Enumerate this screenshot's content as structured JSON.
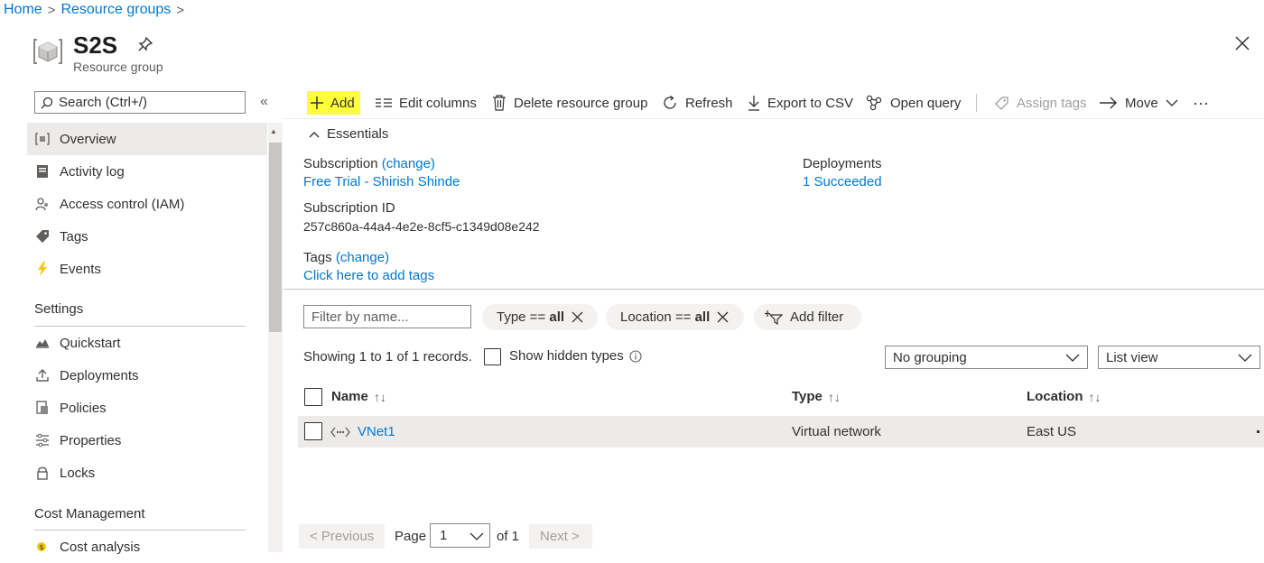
{
  "breadcrumb": {
    "home": "Home",
    "resource_groups": "Resource groups",
    "separator": ">"
  },
  "header": {
    "title": "S2S",
    "subtitle": "Resource group"
  },
  "sidebar": {
    "search_placeholder": "Search (Ctrl+/)",
    "collapse_glyph": "«",
    "items": [
      {
        "label": "Overview",
        "icon": "overview-icon"
      },
      {
        "label": "Activity log",
        "icon": "activity-log-icon"
      },
      {
        "label": "Access control (IAM)",
        "icon": "iam-icon"
      },
      {
        "label": "Tags",
        "icon": "tag-icon"
      },
      {
        "label": "Events",
        "icon": "lightning-icon"
      }
    ],
    "settings_heading": "Settings",
    "settings_items": [
      {
        "label": "Quickstart",
        "icon": "quickstart-icon"
      },
      {
        "label": "Deployments",
        "icon": "upload-icon"
      },
      {
        "label": "Policies",
        "icon": "policy-icon"
      },
      {
        "label": "Properties",
        "icon": "properties-icon"
      },
      {
        "label": "Locks",
        "icon": "lock-icon"
      }
    ],
    "cost_heading": "Cost Management",
    "cost_items": [
      {
        "label": "Cost analysis",
        "icon": "cost-analysis-icon"
      }
    ]
  },
  "toolbar": {
    "add": "Add",
    "edit_columns": "Edit columns",
    "delete": "Delete resource group",
    "refresh": "Refresh",
    "export": "Export to CSV",
    "open_query": "Open query",
    "assign_tags": "Assign tags",
    "move": "Move",
    "more": "···"
  },
  "essentials": {
    "toggle": "Essentials",
    "subscription_label": "Subscription",
    "change": "(change)",
    "subscription_value": "Free Trial - Shirish Shinde",
    "subscription_id_label": "Subscription ID",
    "subscription_id_value": "257c860a-44a4-4e2e-8cf5-c1349d08e242",
    "tags_label": "Tags",
    "tags_value": "Click here to add tags",
    "deployments_label": "Deployments",
    "deployments_value": "1 Succeeded"
  },
  "filters": {
    "name_placeholder": "Filter by name...",
    "type_pill_label": "Type ==",
    "type_pill_value": "all",
    "location_pill_label": "Location ==",
    "location_pill_value": "all",
    "add_filter": "Add filter"
  },
  "records": {
    "summary": "Showing 1 to 1 of 1 records.",
    "show_hidden": "Show hidden types",
    "grouping": "No grouping",
    "view": "List view"
  },
  "table": {
    "columns": [
      "Name",
      "Type",
      "Location"
    ],
    "rows": [
      {
        "name": "VNet1",
        "type": "Virtual network",
        "location": "East US"
      }
    ]
  },
  "pagination": {
    "previous": "< Previous",
    "page_label": "Page",
    "page_value": "1",
    "of": "of 1",
    "next": "Next >"
  },
  "colors": {
    "accent": "#0078d4",
    "highlight": "#ffff3a",
    "selected_row": "#edebe9"
  }
}
